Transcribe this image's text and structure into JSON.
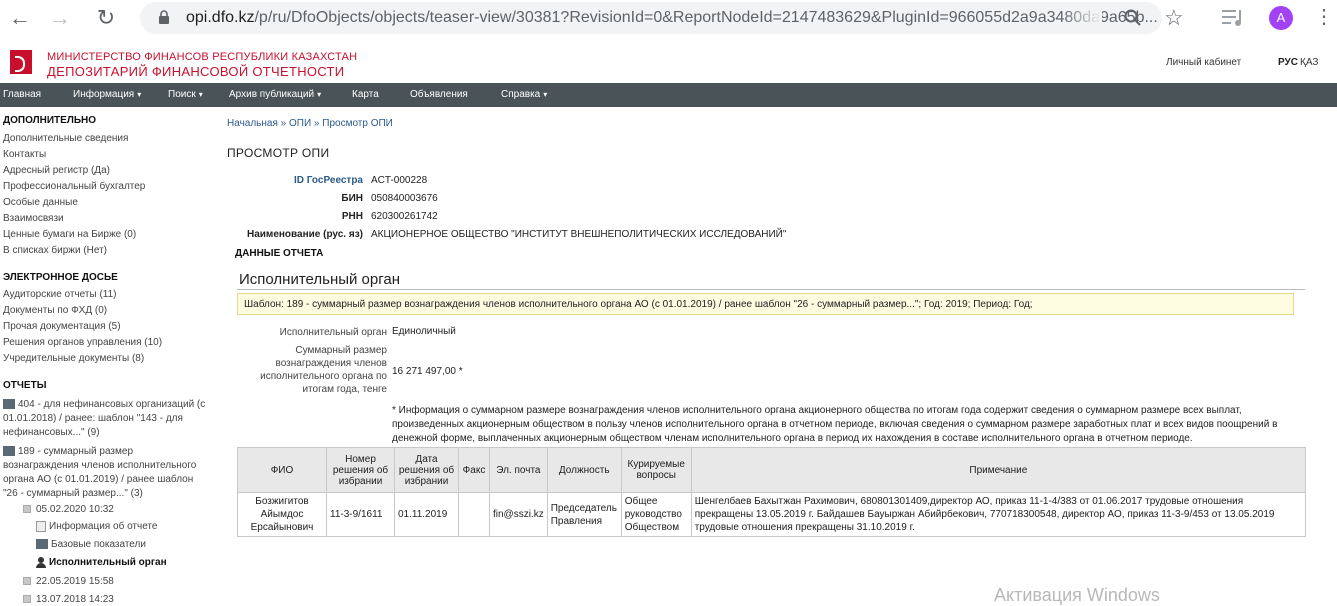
{
  "browser": {
    "url_host": "opi.dfo.kz",
    "url_path": "/p/ru/DfoObjects/objects/teaser-view/30381?RevisionId=0&ReportNodeId=2147483629&PluginId=966055d2a9a3480da9a65b...",
    "avatar_letter": "A"
  },
  "header": {
    "ministry": "МИНИСТЕРСТВО ФИНАНСОВ РЕСПУБЛИКИ КАЗАХСТАН",
    "depository": "ДЕПОЗИТАРИЙ ФИНАНСОВОЙ ОТЧЕТНОСТИ",
    "cabinet": "Личный кабинет",
    "lang_active": "РУС",
    "lang_other": "ҚАЗ"
  },
  "menu": [
    {
      "label": "Главная"
    },
    {
      "label": "Информация",
      "caret": "▾"
    },
    {
      "label": "Поиск",
      "caret": "▾"
    },
    {
      "label": "Архив публикаций",
      "caret": "▾"
    },
    {
      "label": "Карта"
    },
    {
      "label": "Объявления"
    },
    {
      "label": "Справка",
      "caret": "▾"
    }
  ],
  "sidebar": {
    "additional_heading": "ДОПОЛНИТЕЛЬНО",
    "additional_items": [
      "Дополнительные сведения",
      "Контакты",
      "Адресный регистр (Да)",
      "Профессиональный бухгалтер",
      "Особые данные",
      "Взаимосвязи",
      "Ценные бумаги на Бирже (0)",
      "В списках биржи (Нет)"
    ],
    "dossier_heading": "ЭЛЕКТРОННОЕ ДОСЬЕ",
    "dossier_items": [
      "Аудиторские отчеты (11)",
      "Документы по ФХД (0)",
      "Прочая документация (5)",
      "Решения органов управления (10)",
      "Учредительные документы (8)"
    ],
    "reports_heading": "ОТЧЕТЫ",
    "report_404": "404 - для нефинансовых организаций (с 01.01.2018) / ранее: шаблон \"143 - для нефинансовых...\" (9)",
    "report_189": "189 - суммарный размер вознаграждения членов исполнительного органа АО (с 01.01.2019) / ранее шаблон \"26 - суммарный размер...\" (3)",
    "date_1": "05.02.2020 10:32",
    "sub_info": "Информация об отчете",
    "sub_base": "Базовые показатели",
    "sub_exec": "Исполнительный орган",
    "date_2": "22.05.2019 15:58",
    "date_3": "13.07.2018 14:23"
  },
  "main": {
    "breadcrumb": "Начальная » ОПИ » Просмотр ОПИ",
    "title": "ПРОСМОТР ОПИ",
    "id_label": "ID ГосРеестра",
    "id_value": "ACT-000228",
    "bin_label": "БИН",
    "bin_value": "050840003676",
    "rnn_label": "РНН",
    "rnn_value": "620300261742",
    "name_label": "Наименование (рус. яз)",
    "name_value": "АКЦИОНЕРНОЕ ОБЩЕСТВО \"ИНСТИТУТ ВНЕШНЕПОЛИТИЧЕСКИХ ИССЛЕДОВАНИЙ\"",
    "report_data": "ДАННЫЕ ОТЧЕТА",
    "section_title": "Исполнительный орган",
    "template": "Шаблон: 189 - суммарный размер вознаграждения членов исполнительного органа АО (с 01.01.2019) / ранее шаблон \"26 - суммарный размер...\"; Год: 2019; Период: Год;",
    "exec_label": "Исполнительный орган",
    "exec_value": "Единоличный",
    "sum_label": "Суммарный размер вознаграждения членов исполнительного органа по итогам года, тенге",
    "sum_value": "16 271 497,00 *",
    "note": "* Информация о суммарном размере вознаграждения членов исполнительного органа акционерного общества по итогам года содержит сведения о суммарном размере всех выплат, произведенных акционерным обществом в пользу членов исполнительного органа в отчетном периоде, включая сведения о суммарном размере заработных плат и всех видов поощрений в денежной форме, выплаченных акционерным обществом членам исполнительного органа в период их нахождения в составе исполнительного органа в отчетном периоде."
  },
  "table": {
    "headers": [
      "ФИО",
      "Номер решения об избрании",
      "Дата решения об избрании",
      "Факс",
      "Эл. почта",
      "Должность",
      "Курируемые вопросы",
      "Примечание"
    ],
    "rows": [
      [
        "Бозжигитов Айымдос Ерсайынович",
        "11-3-9/1611",
        "01.11.2019",
        "",
        "fin@sszi.kz",
        "Председатель Правления",
        "Общее руководство Обществом",
        "Шенгелбаев Бахытжан Рахимович, 680801301409,директор АО, приказ 11-1-4/383 от 01.06.2017 трудовые отношения прекращены 13.05.2019 г. Байдашев Бауыржан Абийрбекович, 770718300548, директор АО, приказ 11-3-9/453 от 13.05.2019 трудовые отношения прекращены 31.10.2019 г."
      ]
    ]
  },
  "watermark": "Активация Windows"
}
